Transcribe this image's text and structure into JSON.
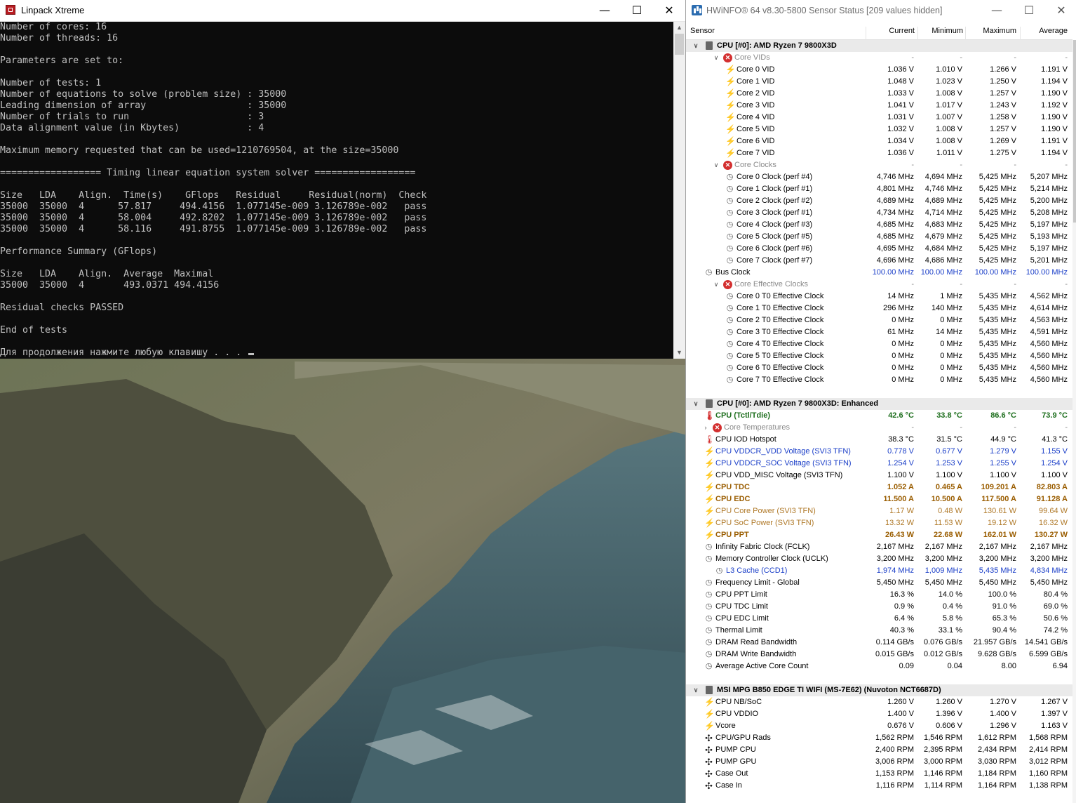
{
  "linpack": {
    "title": "Linpack Xtreme",
    "buttons": {
      "minimize": "—",
      "maximize": "☐",
      "close": "✕"
    },
    "console_lines": [
      "Number of cores: 16",
      "Number of threads: 16",
      "",
      "Parameters are set to:",
      "",
      "Number of tests: 1",
      "Number of equations to solve (problem size) : 35000",
      "Leading dimension of array                  : 35000",
      "Number of trials to run                     : 3",
      "Data alignment value (in Kbytes)            : 4",
      "",
      "Maximum memory requested that can be used=1210769504, at the size=35000",
      "",
      "================== Timing linear equation system solver ==================",
      "",
      "Size   LDA    Align.  Time(s)    GFlops   Residual     Residual(norm)  Check",
      "35000  35000  4      57.817     494.4156  1.077145e-009 3.126789e-002   pass",
      "35000  35000  4      58.004     492.8202  1.077145e-009 3.126789e-002   pass",
      "35000  35000  4      58.116     491.8755  1.077145e-009 3.126789e-002   pass",
      "",
      "Performance Summary (GFlops)",
      "",
      "Size   LDA    Align.  Average  Maximal",
      "35000  35000  4       493.0371 494.4156",
      "",
      "Residual checks PASSED",
      "",
      "End of tests",
      "",
      "Для продолжения нажмите любую клавишу . . . "
    ]
  },
  "hwinfo": {
    "title": "HWiNFO® 64 v8.30-5800 Sensor Status [209 values hidden]",
    "buttons": {
      "minimize": "—",
      "maximize": "☐",
      "close": "✕"
    },
    "columns": [
      "Sensor",
      "Current",
      "Minimum",
      "Maximum",
      "Average"
    ],
    "rows": [
      {
        "type": "header",
        "indent": 0,
        "exp": "∨",
        "icon": "chip",
        "label": "CPU [#0]: AMD Ryzen 7 9800X3D",
        "v": [
          "",
          "",
          "",
          ""
        ]
      },
      {
        "type": "dim",
        "indent": 1,
        "exp": "∨",
        "icon": "x",
        "label": "Core VIDs",
        "v": [
          "-",
          "-",
          "-",
          "-"
        ]
      },
      {
        "type": "",
        "indent": 2,
        "exp": "",
        "icon": "bolt",
        "label": "Core 0 VID",
        "v": [
          "1.036 V",
          "1.010 V",
          "1.266 V",
          "1.191 V"
        ]
      },
      {
        "type": "",
        "indent": 2,
        "exp": "",
        "icon": "bolt",
        "label": "Core 1 VID",
        "v": [
          "1.048 V",
          "1.023 V",
          "1.250 V",
          "1.194 V"
        ]
      },
      {
        "type": "",
        "indent": 2,
        "exp": "",
        "icon": "bolt",
        "label": "Core 2 VID",
        "v": [
          "1.033 V",
          "1.008 V",
          "1.257 V",
          "1.190 V"
        ]
      },
      {
        "type": "",
        "indent": 2,
        "exp": "",
        "icon": "bolt",
        "label": "Core 3 VID",
        "v": [
          "1.041 V",
          "1.017 V",
          "1.243 V",
          "1.192 V"
        ]
      },
      {
        "type": "",
        "indent": 2,
        "exp": "",
        "icon": "bolt",
        "label": "Core 4 VID",
        "v": [
          "1.031 V",
          "1.007 V",
          "1.258 V",
          "1.190 V"
        ]
      },
      {
        "type": "",
        "indent": 2,
        "exp": "",
        "icon": "bolt",
        "label": "Core 5 VID",
        "v": [
          "1.032 V",
          "1.008 V",
          "1.257 V",
          "1.190 V"
        ]
      },
      {
        "type": "",
        "indent": 2,
        "exp": "",
        "icon": "bolt",
        "label": "Core 6 VID",
        "v": [
          "1.034 V",
          "1.008 V",
          "1.269 V",
          "1.191 V"
        ]
      },
      {
        "type": "",
        "indent": 2,
        "exp": "",
        "icon": "bolt",
        "label": "Core 7 VID",
        "v": [
          "1.036 V",
          "1.011 V",
          "1.275 V",
          "1.194 V"
        ]
      },
      {
        "type": "dim",
        "indent": 1,
        "exp": "∨",
        "icon": "x",
        "label": "Core Clocks",
        "v": [
          "-",
          "-",
          "-",
          "-"
        ]
      },
      {
        "type": "",
        "indent": 2,
        "exp": "",
        "icon": "clock",
        "label": "Core 0 Clock (perf #4)",
        "v": [
          "4,746 MHz",
          "4,694 MHz",
          "5,425 MHz",
          "5,207 MHz"
        ]
      },
      {
        "type": "",
        "indent": 2,
        "exp": "",
        "icon": "clock",
        "label": "Core 1 Clock (perf #1)",
        "v": [
          "4,801 MHz",
          "4,746 MHz",
          "5,425 MHz",
          "5,214 MHz"
        ]
      },
      {
        "type": "",
        "indent": 2,
        "exp": "",
        "icon": "clock",
        "label": "Core 2 Clock (perf #2)",
        "v": [
          "4,689 MHz",
          "4,689 MHz",
          "5,425 MHz",
          "5,200 MHz"
        ]
      },
      {
        "type": "",
        "indent": 2,
        "exp": "",
        "icon": "clock",
        "label": "Core 3 Clock (perf #1)",
        "v": [
          "4,734 MHz",
          "4,714 MHz",
          "5,425 MHz",
          "5,208 MHz"
        ]
      },
      {
        "type": "",
        "indent": 2,
        "exp": "",
        "icon": "clock",
        "label": "Core 4 Clock (perf #3)",
        "v": [
          "4,685 MHz",
          "4,683 MHz",
          "5,425 MHz",
          "5,197 MHz"
        ]
      },
      {
        "type": "",
        "indent": 2,
        "exp": "",
        "icon": "clock",
        "label": "Core 5 Clock (perf #5)",
        "v": [
          "4,685 MHz",
          "4,679 MHz",
          "5,425 MHz",
          "5,193 MHz"
        ]
      },
      {
        "type": "",
        "indent": 2,
        "exp": "",
        "icon": "clock",
        "label": "Core 6 Clock (perf #6)",
        "v": [
          "4,695 MHz",
          "4,684 MHz",
          "5,425 MHz",
          "5,197 MHz"
        ]
      },
      {
        "type": "",
        "indent": 2,
        "exp": "",
        "icon": "clock",
        "label": "Core 7 Clock (perf #7)",
        "v": [
          "4,696 MHz",
          "4,686 MHz",
          "5,425 MHz",
          "5,201 MHz"
        ]
      },
      {
        "type": "purple",
        "indent": 0,
        "exp": "",
        "icon": "clock",
        "label": "Bus Clock",
        "v": [
          "100.00 MHz",
          "100.00 MHz",
          "100.00 MHz",
          "100.00 MHz"
        ]
      },
      {
        "type": "dim",
        "indent": 1,
        "exp": "∨",
        "icon": "x",
        "label": "Core Effective Clocks",
        "v": [
          "-",
          "-",
          "-",
          "-"
        ]
      },
      {
        "type": "",
        "indent": 2,
        "exp": "",
        "icon": "clock",
        "label": "Core 0 T0 Effective Clock",
        "v": [
          "14 MHz",
          "1 MHz",
          "5,435 MHz",
          "4,562 MHz"
        ]
      },
      {
        "type": "",
        "indent": 2,
        "exp": "",
        "icon": "clock",
        "label": "Core 1 T0 Effective Clock",
        "v": [
          "296 MHz",
          "140 MHz",
          "5,435 MHz",
          "4,614 MHz"
        ]
      },
      {
        "type": "",
        "indent": 2,
        "exp": "",
        "icon": "clock",
        "label": "Core 2 T0 Effective Clock",
        "v": [
          "0 MHz",
          "0 MHz",
          "5,435 MHz",
          "4,563 MHz"
        ]
      },
      {
        "type": "",
        "indent": 2,
        "exp": "",
        "icon": "clock",
        "label": "Core 3 T0 Effective Clock",
        "v": [
          "61 MHz",
          "14 MHz",
          "5,435 MHz",
          "4,591 MHz"
        ]
      },
      {
        "type": "",
        "indent": 2,
        "exp": "",
        "icon": "clock",
        "label": "Core 4 T0 Effective Clock",
        "v": [
          "0 MHz",
          "0 MHz",
          "5,435 MHz",
          "4,560 MHz"
        ]
      },
      {
        "type": "",
        "indent": 2,
        "exp": "",
        "icon": "clock",
        "label": "Core 5 T0 Effective Clock",
        "v": [
          "0 MHz",
          "0 MHz",
          "5,435 MHz",
          "4,560 MHz"
        ]
      },
      {
        "type": "",
        "indent": 2,
        "exp": "",
        "icon": "clock",
        "label": "Core 6 T0 Effective Clock",
        "v": [
          "0 MHz",
          "0 MHz",
          "5,435 MHz",
          "4,560 MHz"
        ]
      },
      {
        "type": "",
        "indent": 2,
        "exp": "",
        "icon": "clock",
        "label": "Core 7 T0 Effective Clock",
        "v": [
          "0 MHz",
          "0 MHz",
          "5,435 MHz",
          "4,560 MHz"
        ]
      },
      {
        "type": "spacer"
      },
      {
        "type": "header",
        "indent": 0,
        "exp": "∨",
        "icon": "chip",
        "label": "CPU [#0]: AMD Ryzen 7 9800X3D: Enhanced",
        "v": [
          "",
          "",
          "",
          ""
        ]
      },
      {
        "type": "green",
        "indent": 0,
        "exp": "",
        "icon": "therm",
        "label": "CPU (Tctl/Tdie)",
        "v": [
          "42.6 °C",
          "33.8 °C",
          "86.6 °C",
          "73.9 °C"
        ]
      },
      {
        "type": "dim",
        "indent": 0,
        "exp": "›",
        "icon": "x",
        "label": "Core Temperatures",
        "v": [
          "-",
          "-",
          "-",
          "-"
        ]
      },
      {
        "type": "",
        "indent": 0,
        "exp": "",
        "icon": "therm",
        "label": "CPU IOD Hotspot",
        "v": [
          "38.3 °C",
          "31.5 °C",
          "44.9 °C",
          "41.3 °C"
        ]
      },
      {
        "type": "blue",
        "indent": 0,
        "exp": "",
        "icon": "bolt",
        "label": "CPU VDDCR_VDD Voltage (SVI3 TFN)",
        "v": [
          "0.778 V",
          "0.677 V",
          "1.279 V",
          "1.155 V"
        ]
      },
      {
        "type": "blue",
        "indent": 0,
        "exp": "",
        "icon": "bolt",
        "label": "CPU VDDCR_SOC Voltage (SVI3 TFN)",
        "v": [
          "1.254 V",
          "1.253 V",
          "1.255 V",
          "1.254 V"
        ]
      },
      {
        "type": "",
        "indent": 0,
        "exp": "",
        "icon": "bolt",
        "label": "CPU VDD_MISC Voltage (SVI3 TFN)",
        "v": [
          "1.100 V",
          "1.100 V",
          "1.100 V",
          "1.100 V"
        ]
      },
      {
        "type": "gold",
        "indent": 0,
        "exp": "",
        "icon": "bolt",
        "label": "CPU TDC",
        "v": [
          "1.052 A",
          "0.465 A",
          "109.201 A",
          "82.803 A"
        ]
      },
      {
        "type": "gold",
        "indent": 0,
        "exp": "",
        "icon": "bolt",
        "label": "CPU EDC",
        "v": [
          "11.500 A",
          "10.500 A",
          "117.500 A",
          "91.128 A"
        ]
      },
      {
        "type": "tan",
        "indent": 0,
        "exp": "",
        "icon": "bolt",
        "label": "CPU Core Power (SVI3 TFN)",
        "v": [
          "1.17 W",
          "0.48 W",
          "130.61 W",
          "99.64 W"
        ]
      },
      {
        "type": "tan",
        "indent": 0,
        "exp": "",
        "icon": "bolt",
        "label": "CPU SoC Power (SVI3 TFN)",
        "v": [
          "13.32 W",
          "11.53 W",
          "19.12 W",
          "16.32 W"
        ]
      },
      {
        "type": "gold",
        "indent": 0,
        "exp": "",
        "icon": "bolt",
        "label": "CPU PPT",
        "v": [
          "26.43 W",
          "22.68 W",
          "162.01 W",
          "130.27 W"
        ]
      },
      {
        "type": "",
        "indent": 0,
        "exp": "",
        "icon": "clock",
        "label": "Infinity Fabric Clock (FCLK)",
        "v": [
          "2,167 MHz",
          "2,167 MHz",
          "2,167 MHz",
          "2,167 MHz"
        ]
      },
      {
        "type": "",
        "indent": 0,
        "exp": "",
        "icon": "clock",
        "label": "Memory Controller Clock (UCLK)",
        "v": [
          "3,200 MHz",
          "3,200 MHz",
          "3,200 MHz",
          "3,200 MHz"
        ]
      },
      {
        "type": "blue",
        "indent": 1,
        "exp": "",
        "icon": "clock",
        "label": "L3 Cache (CCD1)",
        "v": [
          "1,974 MHz",
          "1,009 MHz",
          "5,435 MHz",
          "4,834 MHz"
        ]
      },
      {
        "type": "",
        "indent": 0,
        "exp": "",
        "icon": "clock",
        "label": "Frequency Limit - Global",
        "v": [
          "5,450 MHz",
          "5,450 MHz",
          "5,450 MHz",
          "5,450 MHz"
        ]
      },
      {
        "type": "",
        "indent": 0,
        "exp": "",
        "icon": "clock",
        "label": "CPU PPT Limit",
        "v": [
          "16.3 %",
          "14.0 %",
          "100.0 %",
          "80.4 %"
        ]
      },
      {
        "type": "",
        "indent": 0,
        "exp": "",
        "icon": "clock",
        "label": "CPU TDC Limit",
        "v": [
          "0.9 %",
          "0.4 %",
          "91.0 %",
          "69.0 %"
        ]
      },
      {
        "type": "",
        "indent": 0,
        "exp": "",
        "icon": "clock",
        "label": "CPU EDC Limit",
        "v": [
          "6.4 %",
          "5.8 %",
          "65.3 %",
          "50.6 %"
        ]
      },
      {
        "type": "",
        "indent": 0,
        "exp": "",
        "icon": "clock",
        "label": "Thermal Limit",
        "v": [
          "40.3 %",
          "33.1 %",
          "90.4 %",
          "74.2 %"
        ]
      },
      {
        "type": "",
        "indent": 0,
        "exp": "",
        "icon": "clock",
        "label": "DRAM Read Bandwidth",
        "v": [
          "0.114 GB/s",
          "0.076 GB/s",
          "21.957 GB/s",
          "14.541 GB/s"
        ]
      },
      {
        "type": "",
        "indent": 0,
        "exp": "",
        "icon": "clock",
        "label": "DRAM Write Bandwidth",
        "v": [
          "0.015 GB/s",
          "0.012 GB/s",
          "9.628 GB/s",
          "6.599 GB/s"
        ]
      },
      {
        "type": "",
        "indent": 0,
        "exp": "",
        "icon": "clock",
        "label": "Average Active Core Count",
        "v": [
          "0.09",
          "0.04",
          "8.00",
          "6.94"
        ]
      },
      {
        "type": "spacer"
      },
      {
        "type": "header",
        "indent": 0,
        "exp": "∨",
        "icon": "chip",
        "label": "MSI MPG B850 EDGE TI WIFI (MS-7E62) (Nuvoton NCT6687D)",
        "v": [
          "",
          "",
          "",
          ""
        ]
      },
      {
        "type": "",
        "indent": 0,
        "exp": "",
        "icon": "bolt",
        "label": "CPU NB/SoC",
        "v": [
          "1.260 V",
          "1.260 V",
          "1.270 V",
          "1.267 V"
        ]
      },
      {
        "type": "",
        "indent": 0,
        "exp": "",
        "icon": "bolt",
        "label": "CPU VDDIO",
        "v": [
          "1.400 V",
          "1.396 V",
          "1.400 V",
          "1.397 V"
        ]
      },
      {
        "type": "",
        "indent": 0,
        "exp": "",
        "icon": "bolt",
        "label": "Vcore",
        "v": [
          "0.676 V",
          "0.606 V",
          "1.296 V",
          "1.163 V"
        ]
      },
      {
        "type": "",
        "indent": 0,
        "exp": "",
        "icon": "fan",
        "label": "CPU/GPU Rads",
        "v": [
          "1,562 RPM",
          "1,546 RPM",
          "1,612 RPM",
          "1,568 RPM"
        ]
      },
      {
        "type": "",
        "indent": 0,
        "exp": "",
        "icon": "fan",
        "label": "PUMP CPU",
        "v": [
          "2,400 RPM",
          "2,395 RPM",
          "2,434 RPM",
          "2,414 RPM"
        ]
      },
      {
        "type": "",
        "indent": 0,
        "exp": "",
        "icon": "fan",
        "label": "PUMP GPU",
        "v": [
          "3,006 RPM",
          "3,000 RPM",
          "3,030 RPM",
          "3,012 RPM"
        ]
      },
      {
        "type": "",
        "indent": 0,
        "exp": "",
        "icon": "fan",
        "label": "Case Out",
        "v": [
          "1,153 RPM",
          "1,146 RPM",
          "1,184 RPM",
          "1,160 RPM"
        ]
      },
      {
        "type": "",
        "indent": 0,
        "exp": "",
        "icon": "fan",
        "label": "Case In",
        "v": [
          "1,116 RPM",
          "1,114 RPM",
          "1,164 RPM",
          "1,138 RPM"
        ]
      }
    ]
  }
}
